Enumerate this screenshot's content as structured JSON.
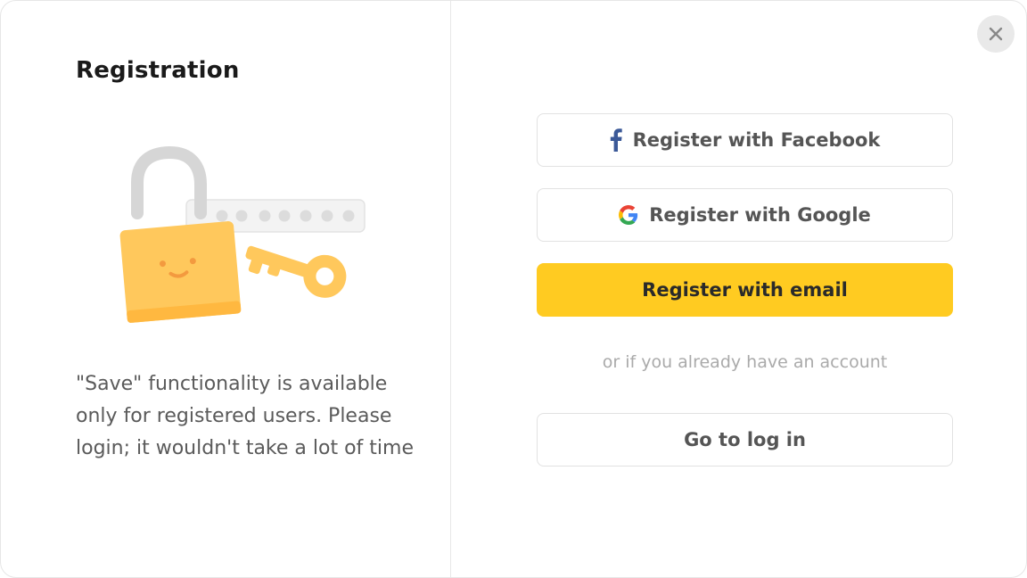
{
  "dialog": {
    "title": "Registration",
    "description": "\"Save\" functionality is available only for registered users. Please login; it wouldn't take a lot of time"
  },
  "buttons": {
    "facebook_label": "Register with Facebook",
    "google_label": "Register with Google",
    "email_label": "Register with email",
    "login_label": "Go to log in"
  },
  "divider_text": "or if you already have an account",
  "icons": {
    "close": "close-icon",
    "facebook": "facebook-icon",
    "google": "google-icon",
    "illustration": "lock-key-illustration"
  },
  "colors": {
    "accent": "#ffcb21",
    "facebook": "#3b5998",
    "lock": "#ffc85c"
  }
}
